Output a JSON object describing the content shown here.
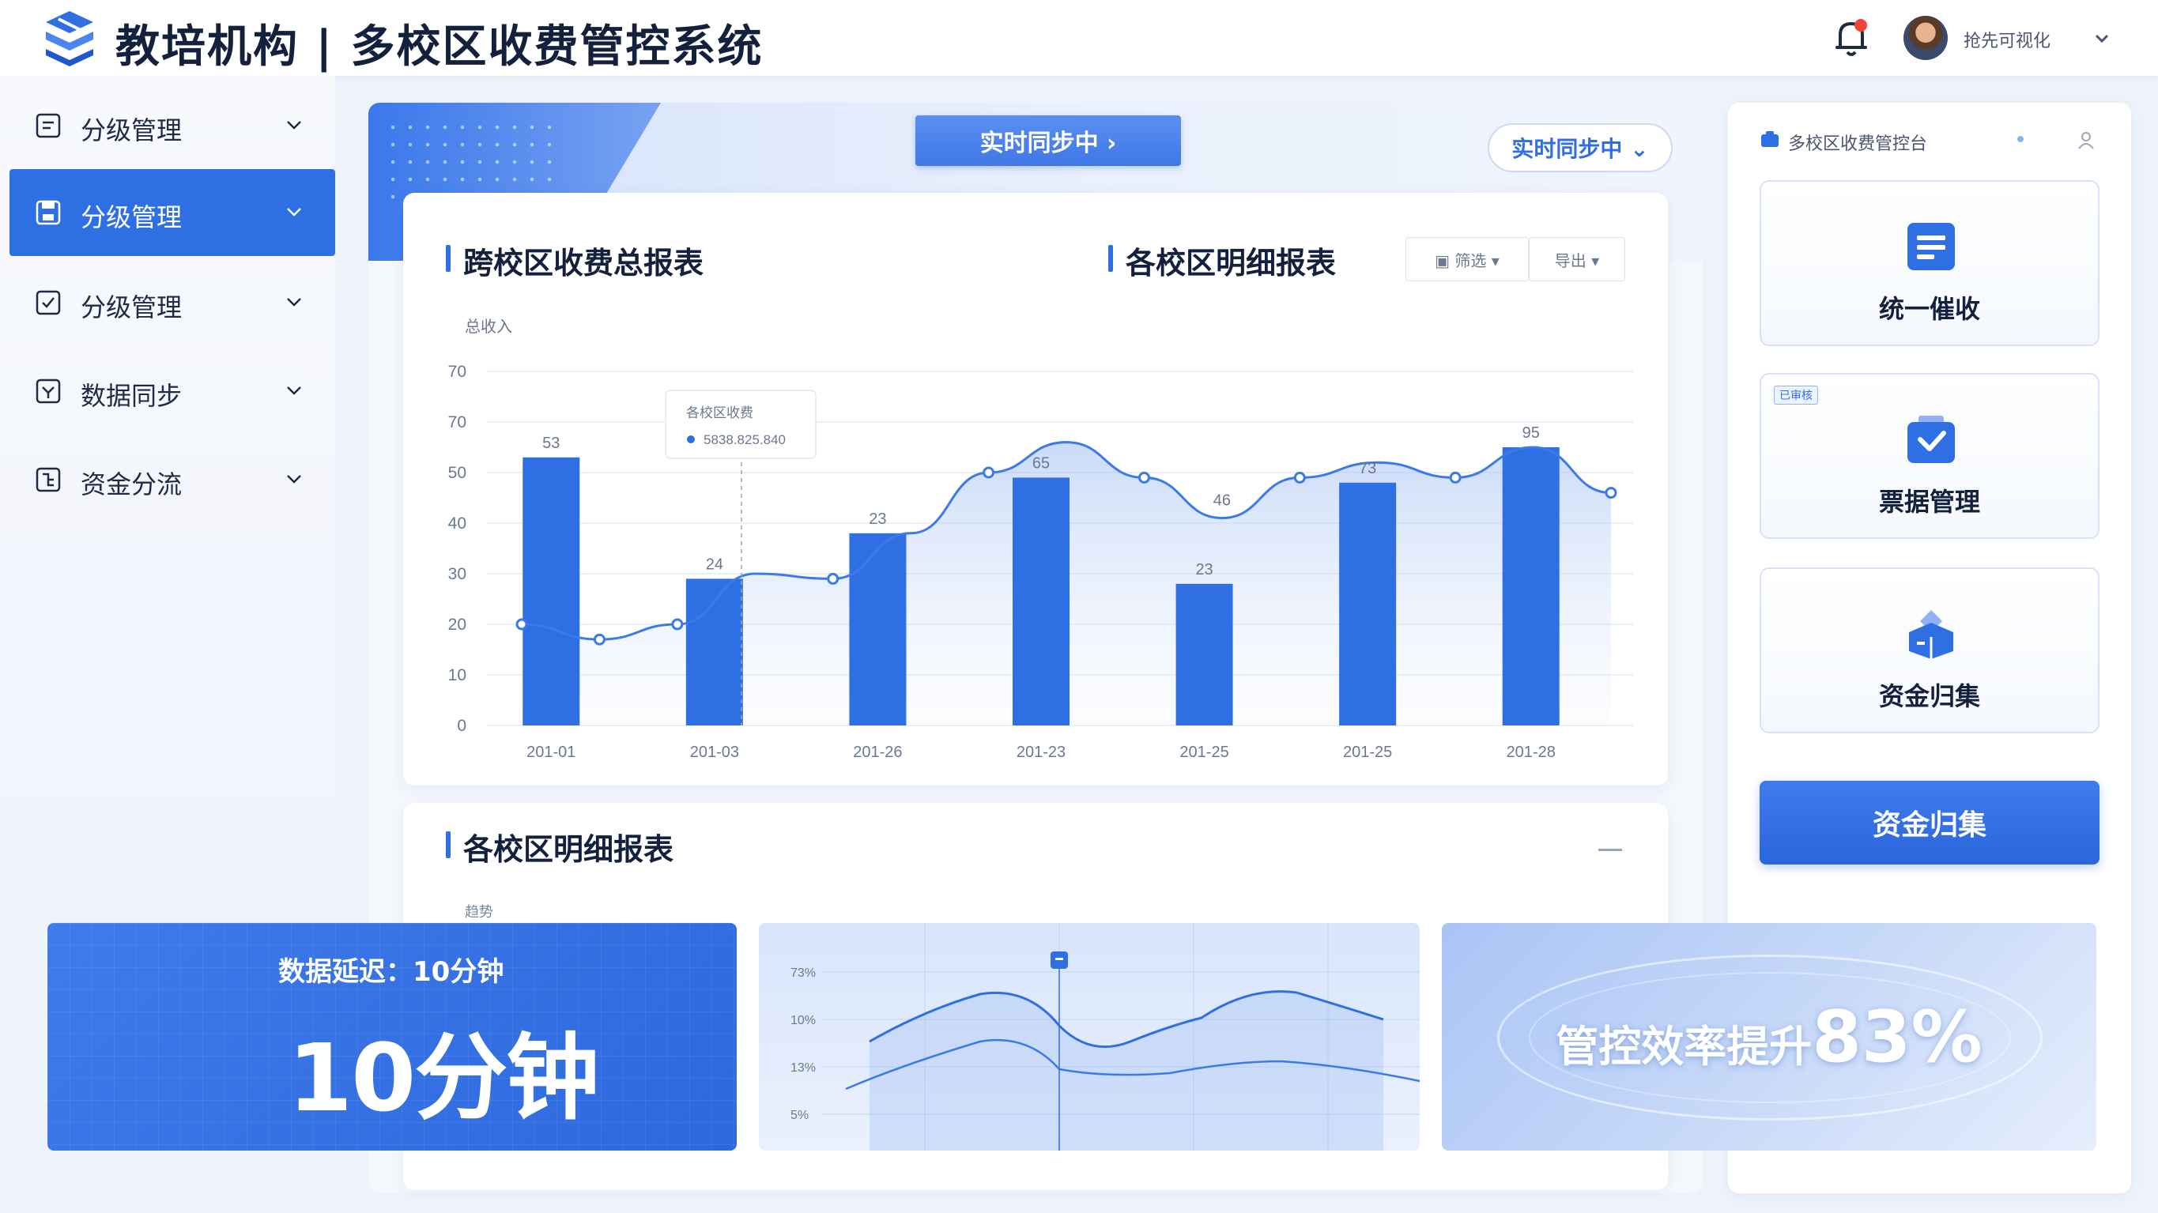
{
  "header": {
    "title": "教培机构 | 多校区收费管控系统",
    "user_name": "抢先可视化",
    "icons": {
      "logo": "stacked-layers-logo",
      "notification": "bell-icon",
      "user_menu": "chevron-down-icon"
    }
  },
  "sidebar": {
    "items": [
      {
        "label": "分级管理",
        "icon": "document-icon",
        "active": false
      },
      {
        "label": "分级管理",
        "icon": "save-icon",
        "active": true
      },
      {
        "label": "分级管理",
        "icon": "check-square-icon",
        "active": false
      },
      {
        "label": "数据同步",
        "icon": "sync-icon",
        "active": false
      },
      {
        "label": "资金分流",
        "icon": "split-icon",
        "active": false
      }
    ]
  },
  "main": {
    "banner_sync_center": "实时同步中 ›",
    "banner_sync_right": "实时同步中 ⌄",
    "summary_title": "跨校区收费总报表",
    "detail_title": "各校区明细报表",
    "filter_1": "▣ 筛选 ▾",
    "filter_2": "导出 ▾",
    "detail_section_title": "各校区明细报表",
    "detail_axis_label": "趋势"
  },
  "chart_data": {
    "type": "bar",
    "ylabel": "总收入",
    "ylim": [
      0,
      70
    ],
    "y_ticks": [
      "0",
      "10",
      "20",
      "30",
      "40",
      "50",
      "70",
      "70"
    ],
    "categories": [
      "201-01",
      "201-03",
      "201-26",
      "201-23",
      "201-25",
      "201-25",
      "201-28"
    ],
    "bar_values": [
      53,
      29,
      38,
      49,
      28,
      48,
      55
    ],
    "bar_labels": [
      "53",
      "24",
      "23",
      "65",
      "23",
      "73",
      "95"
    ],
    "line_values": [
      20,
      17,
      20,
      30,
      29,
      38,
      50,
      56,
      49,
      41,
      49,
      52,
      49,
      55,
      46
    ],
    "line_annotation": "46",
    "tooltip": {
      "title": "各校区收费",
      "value": "5838.825.840"
    },
    "colors": {
      "bar": "#2f6fe4",
      "line": "#3a7be8",
      "area": "#dfe9fb"
    }
  },
  "right_panel": {
    "title": "多校区收费管控台",
    "actions": [
      {
        "label": "统一催收",
        "icon": "list-doc-icon",
        "tag": ""
      },
      {
        "label": "票据管理",
        "icon": "check-box-icon",
        "tag": "已审核"
      },
      {
        "label": "资金归集",
        "icon": "cube-icon",
        "tag": ""
      }
    ],
    "primary_button": "资金归集"
  },
  "stats": {
    "latency_caption": "数据延迟：10分钟",
    "latency_value": "10分钟",
    "trend_ticks": [
      "73%",
      "10%",
      "13%",
      "5%"
    ],
    "efficiency_label": "管控效率提升",
    "efficiency_pct": "83%"
  }
}
